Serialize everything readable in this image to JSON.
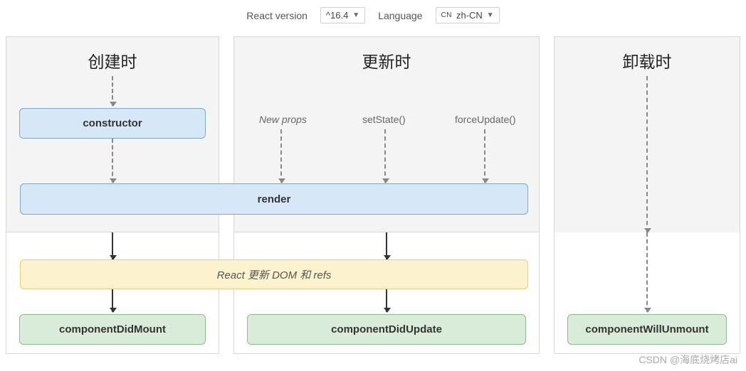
{
  "controls": {
    "version_label": "React version",
    "version_value": "^16.4",
    "language_label": "Language",
    "language_pre": "CN",
    "language_value": "zh-CN"
  },
  "columns": {
    "mount": {
      "title": "创建时",
      "constructor": "constructor",
      "didMount": "componentDidMount"
    },
    "update": {
      "title": "更新时",
      "triggers": {
        "newProps": "New props",
        "setState": "setState()",
        "forceUpdate": "forceUpdate()"
      },
      "didUpdate": "componentDidUpdate"
    },
    "unmount": {
      "title": "卸载时",
      "willUnmount": "componentWillUnmount"
    }
  },
  "shared": {
    "render": "render",
    "commit": "React 更新 DOM 和 refs"
  },
  "watermark": "CSDN @海底烧烤店ai"
}
